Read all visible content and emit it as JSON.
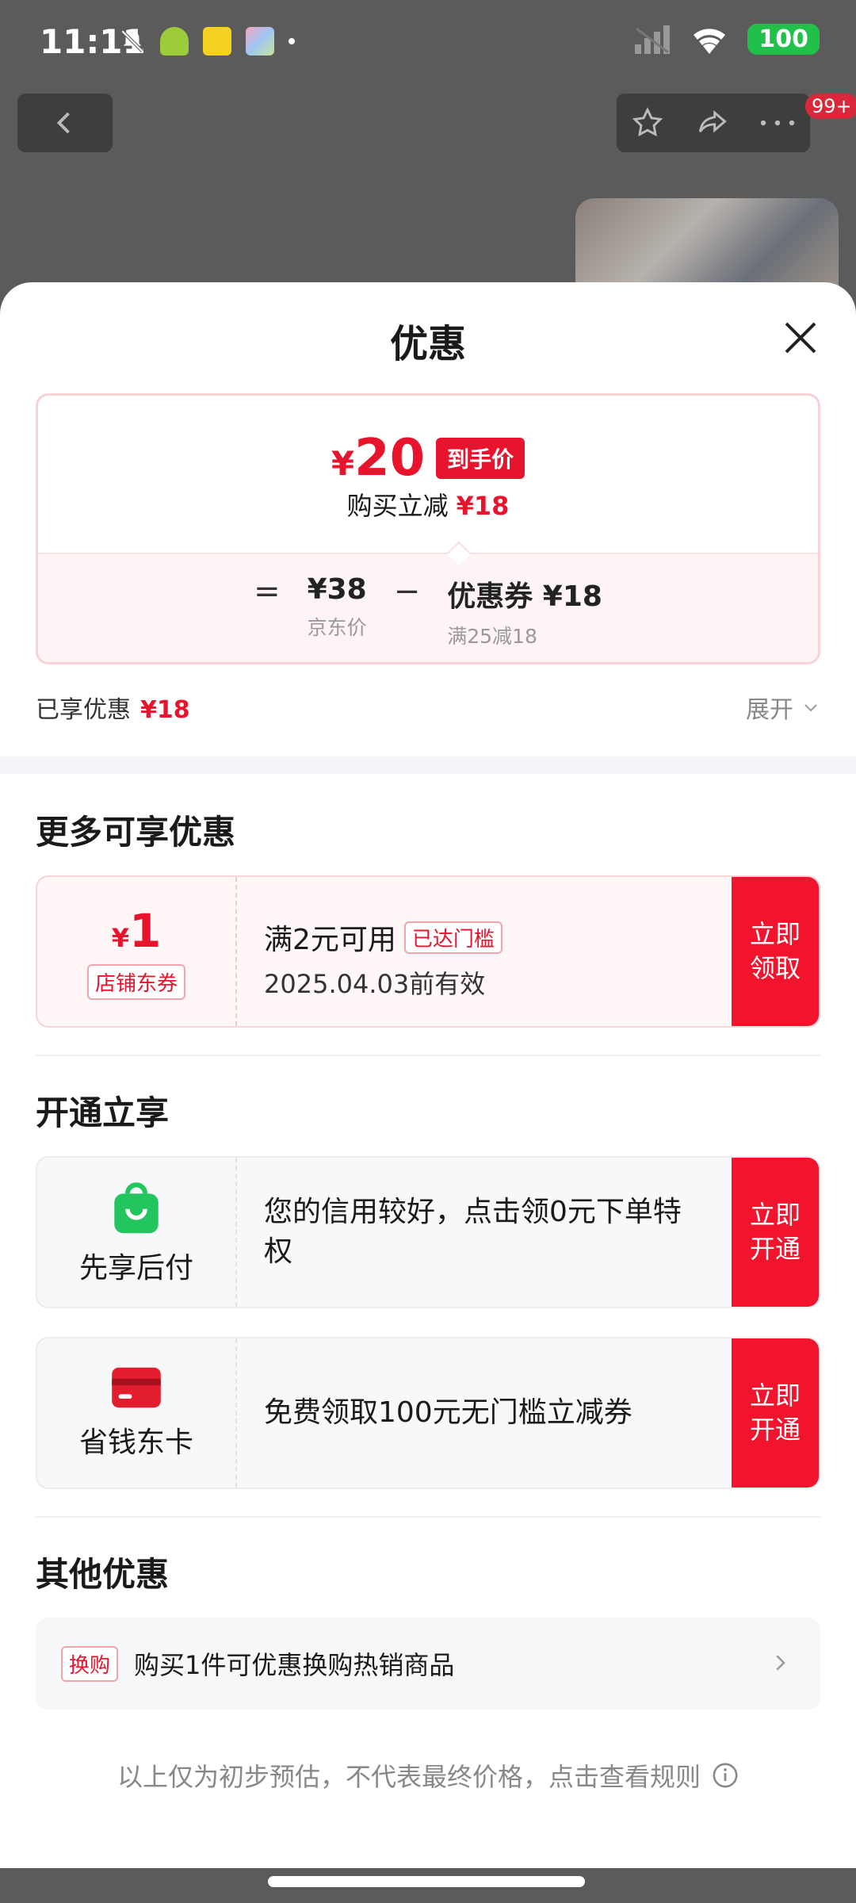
{
  "status_bar": {
    "time": "11:11",
    "battery": "100"
  },
  "top_bar": {
    "badge": "99+"
  },
  "sheet": {
    "title": "优惠",
    "price_card": {
      "currency": "¥",
      "final_price": "20",
      "final_tag": "到手价",
      "reduce_label": "购买立减",
      "reduce_amount": "¥18",
      "equals": "=",
      "jd_price": "¥38",
      "jd_price_label": "京东价",
      "minus": "−",
      "coupon_line": "优惠券 ¥18",
      "coupon_rule": "满25减18"
    },
    "enjoyed_label": "已享优惠",
    "enjoyed_amount": "¥18",
    "expand_label": "展开"
  },
  "more_offers": {
    "title": "更多可享优惠",
    "coupon": {
      "currency": "¥",
      "amount": "1",
      "kind": "店铺东券",
      "condition": "满2元可用",
      "reached_tag": "已达门槛",
      "validity": "2025.04.03前有效",
      "cta_line1": "立即",
      "cta_line2": "领取"
    }
  },
  "open_enjoy": {
    "title": "开通立享",
    "items": [
      {
        "name": "先享后付",
        "desc": "您的信用较好，点击领0元下单特权",
        "cta_line1": "立即",
        "cta_line2": "开通"
      },
      {
        "name": "省钱东卡",
        "desc": "免费领取100元无门槛立减券",
        "cta_line1": "立即",
        "cta_line2": "开通"
      }
    ]
  },
  "other_offers": {
    "title": "其他优惠",
    "tag": "换购",
    "text": "购买1件可优惠换购热销商品"
  },
  "footnote": "以上仅为初步预估，不代表最终价格，点击查看规则",
  "colors": {
    "accent_red": "#e8142d",
    "wallet_green": "#22c55e",
    "card_red": "#e11d2e"
  }
}
